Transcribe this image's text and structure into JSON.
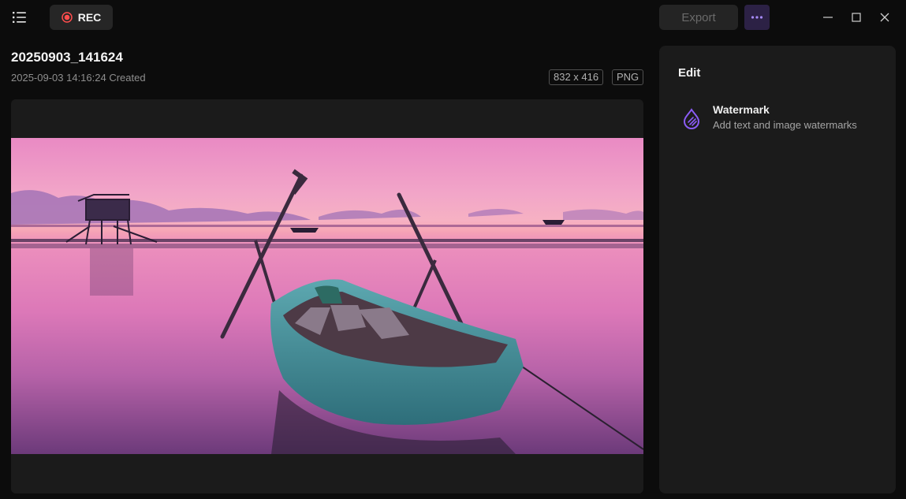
{
  "toolbar": {
    "rec_label": "REC",
    "export_label": "Export"
  },
  "file": {
    "name": "20250903_141624",
    "created": "2025-09-03 14:16:24 Created",
    "dimensions": "832 x 416",
    "format": "PNG"
  },
  "edit_panel": {
    "title": "Edit",
    "items": [
      {
        "title": "Watermark",
        "description": "Add text and image watermarks",
        "icon": "watermark-drop-icon"
      }
    ]
  },
  "colors": {
    "accent": "#8b5cf6",
    "rec_red": "#ff4d4d",
    "background": "#0c0c0c",
    "panel": "#1b1b1b"
  }
}
